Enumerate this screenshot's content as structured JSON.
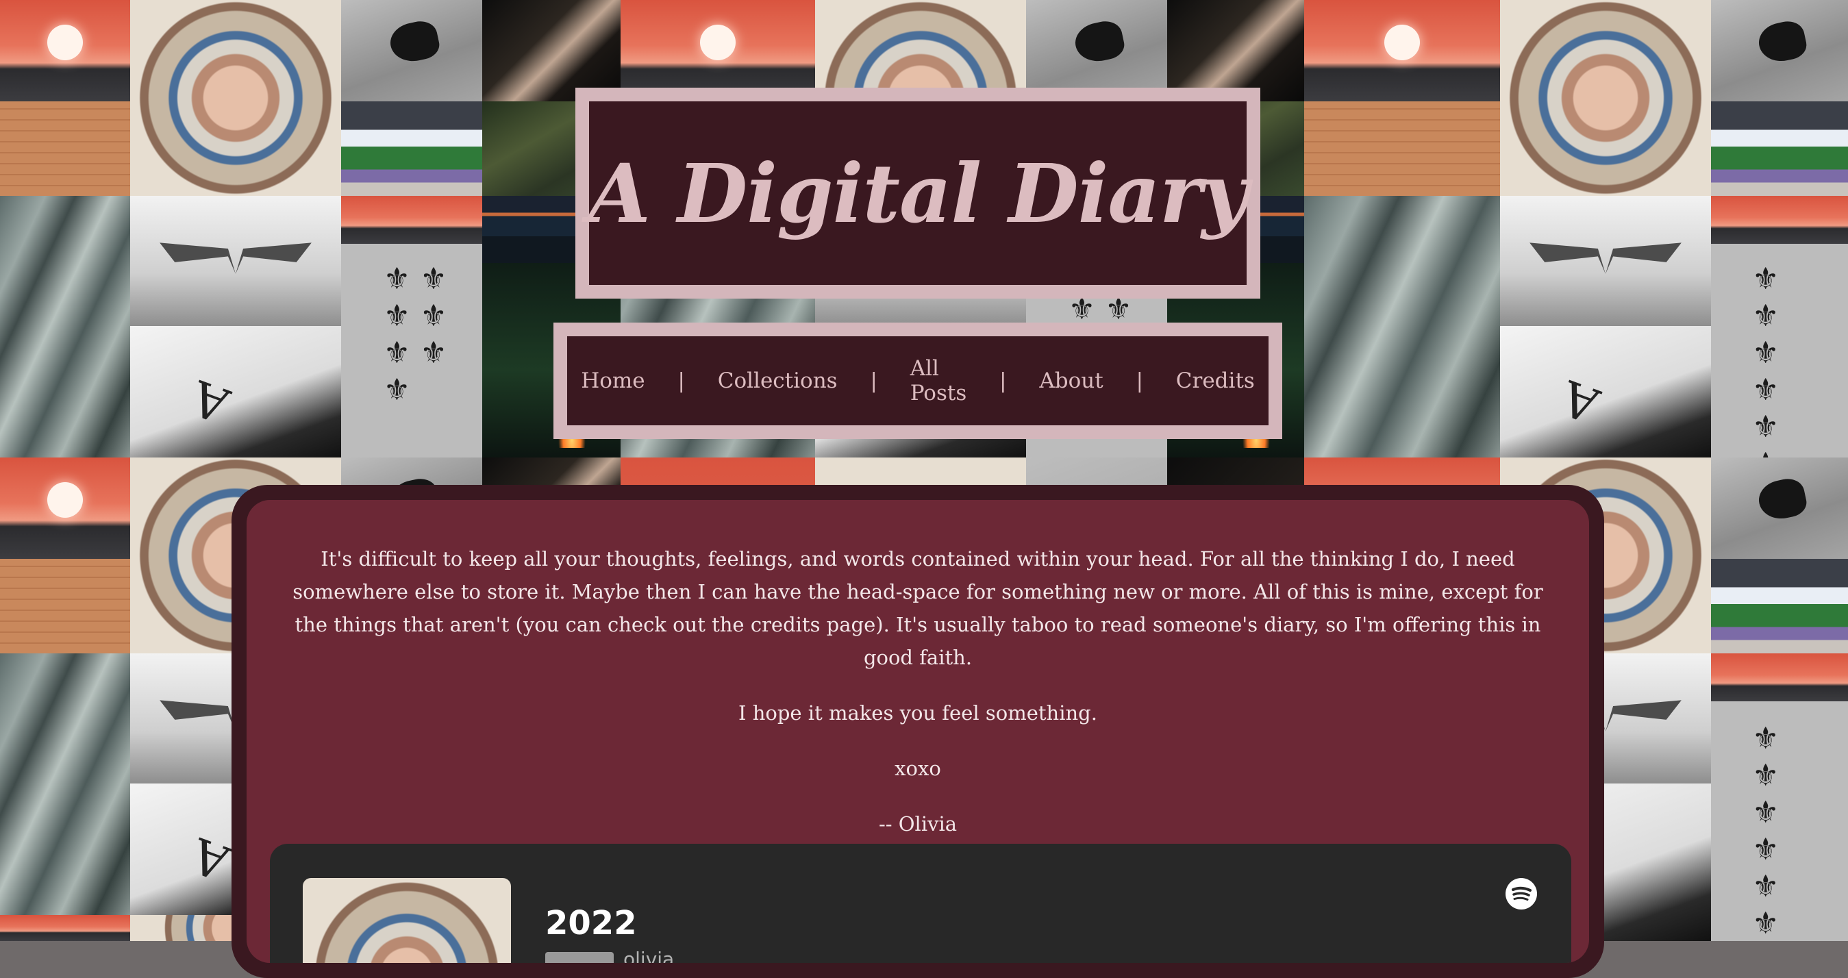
{
  "site": {
    "title": "A Digital Diary"
  },
  "nav": {
    "items": [
      {
        "label": "Home"
      },
      {
        "label": "Collections"
      },
      {
        "label": "All Posts"
      },
      {
        "label": "About"
      },
      {
        "label": "Credits"
      }
    ],
    "separator": "|"
  },
  "intro": {
    "paragraph": "It's difficult to keep all your thoughts, feelings, and words contained within your head. For all the thinking I do, I need somewhere else to store it. Maybe then I can have the head-space for something new or more. All of this is mine, except for the things that aren't (you can check out the credits page). It's usually taboo to read someone's diary, so I'm offering this in good faith.",
    "line2": "I hope it makes you feel something.",
    "signoff": "xoxo",
    "signature": "-- Olivia"
  },
  "embed": {
    "album_title": "2022",
    "artist": "olivia",
    "badge": "",
    "icon": "spotify-icon"
  },
  "colors": {
    "frame": "#d4b6bb",
    "dark": "#3a1820",
    "panel": "#6c2836",
    "embed_bg": "#282828"
  }
}
